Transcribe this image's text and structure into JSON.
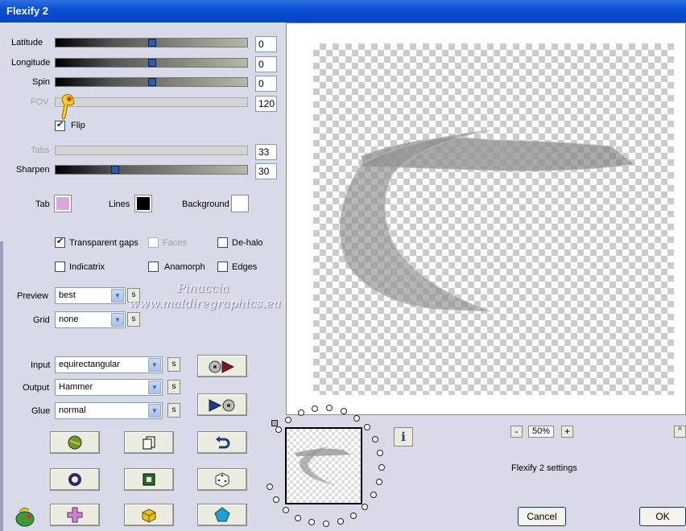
{
  "window": {
    "title": "Flexify 2"
  },
  "sliders": [
    {
      "label": "Latitude",
      "value": "0",
      "level": 0.5
    },
    {
      "label": "Longitude",
      "value": "0",
      "level": 0.5
    },
    {
      "label": "Spin",
      "value": "0",
      "level": 0.5
    },
    {
      "label": "FOV",
      "value": "120",
      "disabled": true
    },
    {
      "label": "Tabs",
      "value": "33",
      "disabled": true
    },
    {
      "label": "Sharpen",
      "value": "30",
      "level": 0.3
    }
  ],
  "flip": {
    "label": "Flip",
    "checked": true
  },
  "colors": {
    "tab_label": "Tab",
    "tab_color": "#d8a8dc",
    "lines_label": "Lines",
    "lines_color": "#000000",
    "background_label": "Background",
    "background_color": "#ffffff"
  },
  "options": {
    "transparent_gaps": "Transparent gaps",
    "faces": "Faces",
    "dehalo": "De-halo",
    "indicatrix": "Indicatrix",
    "anamorph": "Anamorph",
    "edges": "Edges"
  },
  "preview": {
    "label": "Preview",
    "value": "best"
  },
  "grid": {
    "label": "Grid",
    "value": "none"
  },
  "input": {
    "label": "Input",
    "value": "equirectangular"
  },
  "output": {
    "label": "Output",
    "value": "Hammer"
  },
  "glue": {
    "label": "Glue",
    "value": "normal"
  },
  "s_label": "s",
  "watermark": {
    "line1": "Pinuccia",
    "line2": "www.maldiregraphics.eu"
  },
  "zoom": {
    "minus": "-",
    "value": "50%",
    "plus": "+"
  },
  "settings_label": "Flexify 2 settings",
  "info_label": "i",
  "scroll_up": "^",
  "buttons": {
    "cancel": "Cancel",
    "ok": "OK"
  }
}
